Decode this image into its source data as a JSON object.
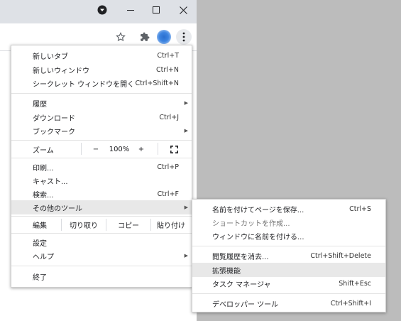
{
  "browser": {
    "window_controls": {
      "minimize": "—",
      "maximize": "☐",
      "close": "✕"
    },
    "toolbar_icons": [
      "star-icon",
      "extensions-icon",
      "profile-avatar",
      "more-vert-icon"
    ]
  },
  "menu": {
    "items_top": [
      {
        "label": "新しいタブ",
        "shortcut": "Ctrl+T"
      },
      {
        "label": "新しいウィンドウ",
        "shortcut": "Ctrl+N"
      },
      {
        "label": "シークレット ウィンドウを開く",
        "shortcut": "Ctrl+Shift+N"
      }
    ],
    "items_mid": [
      {
        "label": "履歴",
        "shortcut": ""
      },
      {
        "label": "ダウンロード",
        "shortcut": "Ctrl+J"
      },
      {
        "label": "ブックマーク",
        "shortcut": ""
      }
    ],
    "zoom": {
      "label": "ズーム",
      "minus": "−",
      "value": "100%",
      "plus": "+"
    },
    "items_tools": [
      {
        "label": "印刷...",
        "shortcut": "Ctrl+P"
      },
      {
        "label": "キャスト...",
        "shortcut": ""
      },
      {
        "label": "検索...",
        "shortcut": "Ctrl+F"
      },
      {
        "label": "その他のツール",
        "shortcut": ""
      }
    ],
    "edit": {
      "label": "編集",
      "cut": "切り取り",
      "copy": "コピー",
      "paste": "貼り付け"
    },
    "items_bottom": [
      {
        "label": "設定",
        "shortcut": ""
      },
      {
        "label": "ヘルプ",
        "shortcut": ""
      }
    ],
    "exit": "終了"
  },
  "submenu": {
    "items": [
      {
        "label": "名前を付けてページを保存...",
        "shortcut": "Ctrl+S"
      },
      {
        "label": "ショートカットを作成...",
        "shortcut": ""
      },
      {
        "label": "ウィンドウに名前を付ける...",
        "shortcut": ""
      },
      {
        "label": "閲覧履歴を消去...",
        "shortcut": "Ctrl+Shift+Delete"
      },
      {
        "label": "拡張機能",
        "shortcut": ""
      },
      {
        "label": "タスク マネージャ",
        "shortcut": "Shift+Esc"
      },
      {
        "label": "デベロッパー ツール",
        "shortcut": "Ctrl+Shift+I"
      }
    ]
  },
  "colors": {
    "highlight": "#e8e8e8",
    "accent": "#3d84e0",
    "desktop": "#bcbcbc"
  }
}
